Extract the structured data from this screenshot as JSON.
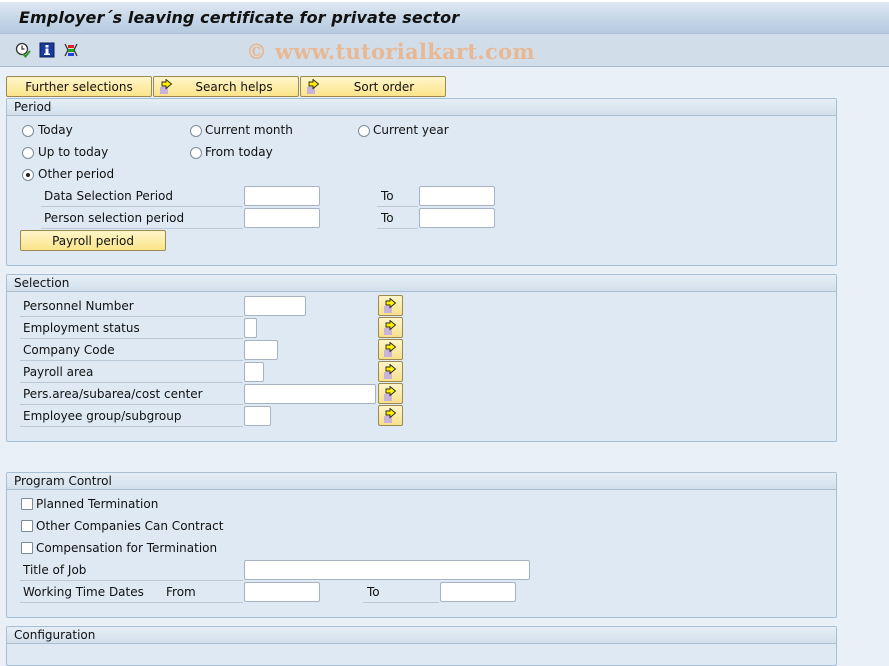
{
  "window": {
    "title": "Employer´s leaving certificate for private sector"
  },
  "toolbar": {
    "icons": [
      "execute-clock-icon",
      "info-icon",
      "selection-options-icon"
    ],
    "watermark": "© www.tutorialkart.com"
  },
  "top_buttons": [
    {
      "label": "Further selections",
      "icon": null
    },
    {
      "label": "Search helps",
      "icon": "arrow-right-icon"
    },
    {
      "label": "Sort order",
      "icon": "arrow-right-icon"
    }
  ],
  "period": {
    "title": "Period",
    "radios": [
      {
        "label": "Today",
        "selected": false
      },
      {
        "label": "Current month",
        "selected": false
      },
      {
        "label": "Current year",
        "selected": false
      },
      {
        "label": "Up to today",
        "selected": false
      },
      {
        "label": "From today",
        "selected": false
      },
      {
        "label": "Other period",
        "selected": true
      }
    ],
    "data_selection_label": "Data Selection Period",
    "data_selection_from": "",
    "data_selection_to_label": "To",
    "data_selection_to": "",
    "person_selection_label": "Person selection period",
    "person_selection_from": "",
    "person_selection_to_label": "To",
    "person_selection_to": "",
    "payroll_button": "Payroll period"
  },
  "selection": {
    "title": "Selection",
    "fields": [
      {
        "label": "Personnel Number",
        "value": ""
      },
      {
        "label": "Employment status",
        "value": ""
      },
      {
        "label": "Company Code",
        "value": ""
      },
      {
        "label": "Payroll area",
        "value": ""
      },
      {
        "label": "Pers.area/subarea/cost center",
        "value": ""
      },
      {
        "label": "Employee group/subgroup",
        "value": ""
      }
    ]
  },
  "program_control": {
    "title": "Program Control",
    "checkboxes": [
      {
        "label": "Planned Termination",
        "checked": false
      },
      {
        "label": "Other Companies Can Contract",
        "checked": false
      },
      {
        "label": "Compensation for Termination",
        "checked": false
      }
    ],
    "title_of_job_label": "Title of Job",
    "title_of_job_value": "",
    "working_time_label": "Working Time Dates",
    "from_label": "From",
    "from_value": "",
    "to_label": "To",
    "to_value": ""
  },
  "configuration": {
    "title": "Configuration"
  }
}
